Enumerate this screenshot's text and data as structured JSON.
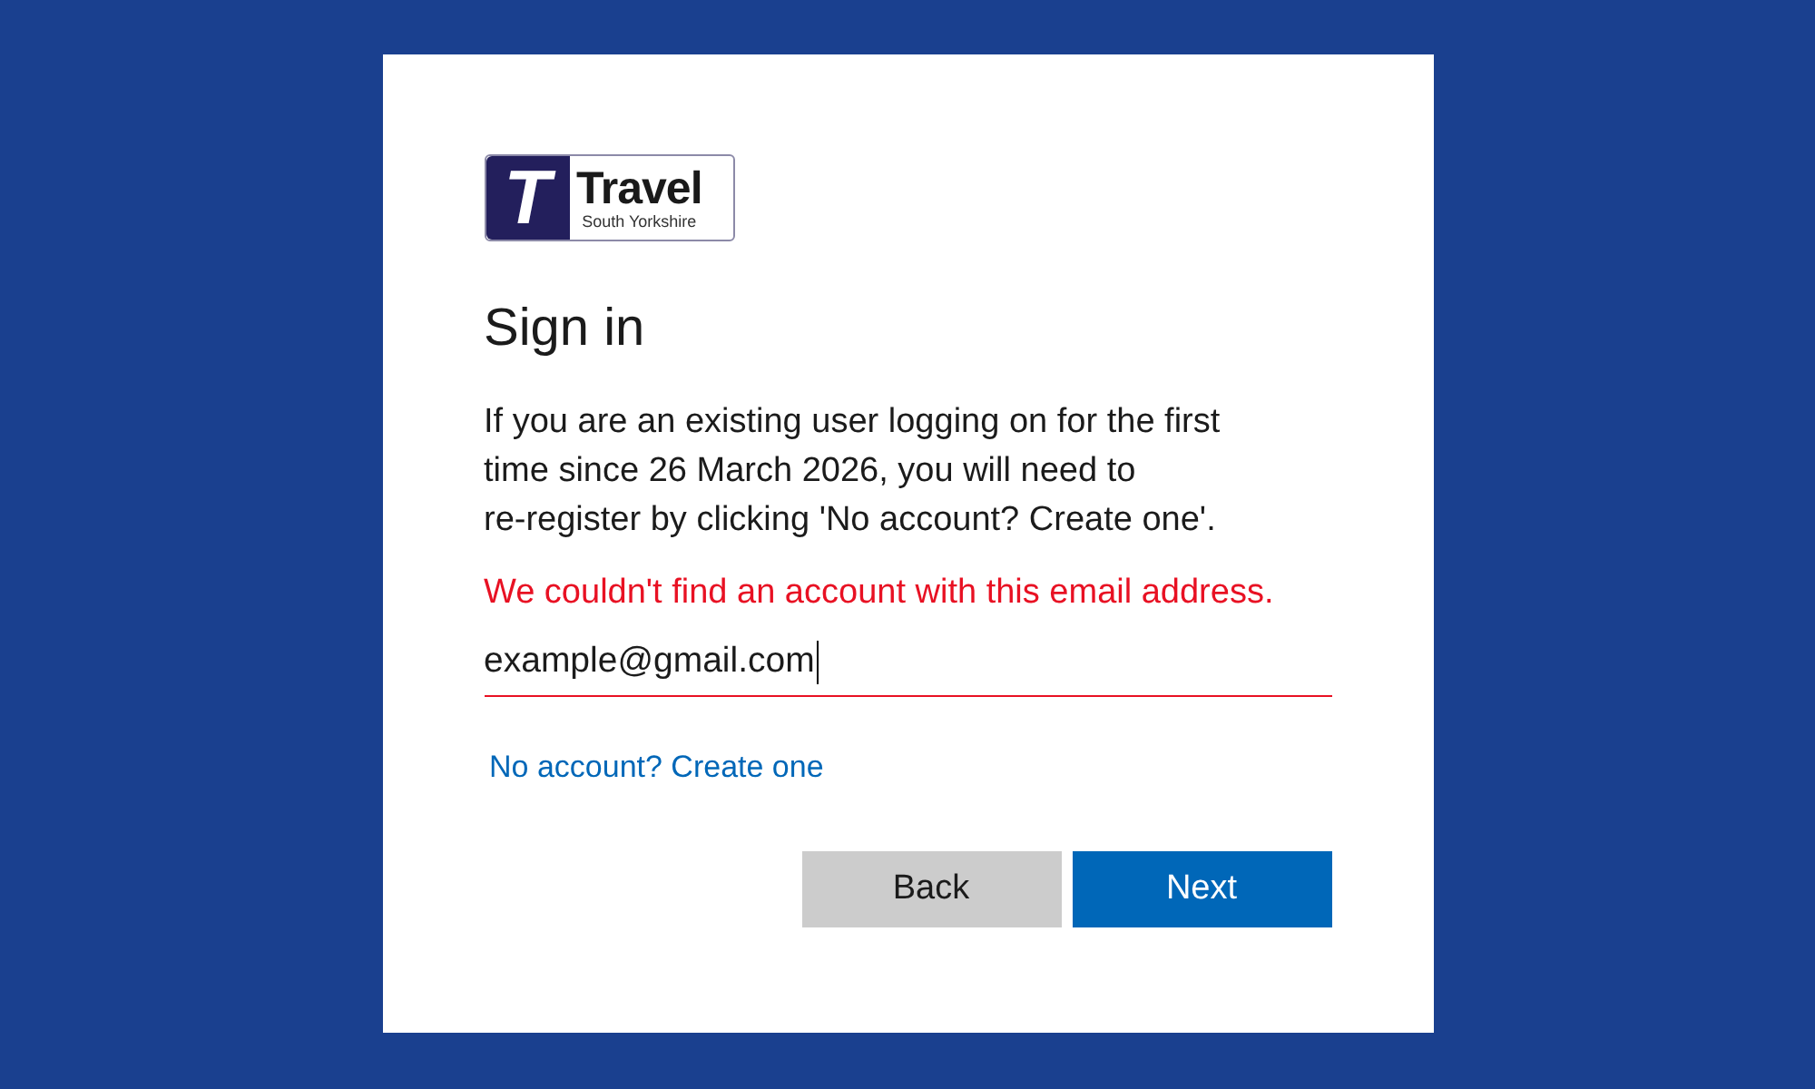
{
  "logo": {
    "letter": "T",
    "name": "Travel",
    "tagline": "South Yorkshire"
  },
  "title": "Sign in",
  "description": "If you are an existing user logging on for the first time since 26 March 2026, you will need to re-register by clicking 'No account? Create one'.",
  "error_message": "We couldn't find an account with this email address.",
  "email_field": {
    "value": "example@gmail.com",
    "focused": true,
    "invalid": true
  },
  "create_account_link": "No account? Create one",
  "buttons": [
    {
      "label": "Back",
      "kind": "secondary"
    },
    {
      "label": "Next",
      "kind": "primary"
    }
  ]
}
